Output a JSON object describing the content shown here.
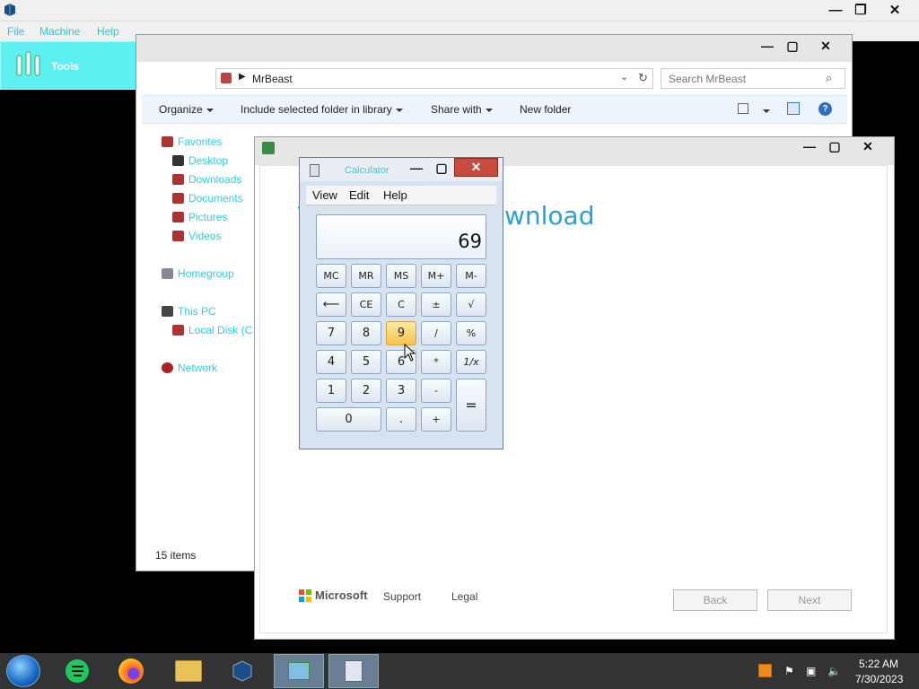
{
  "virtualbox": {
    "menu": [
      "File",
      "Machine",
      "Help"
    ],
    "tools_label": "Tools",
    "controls": [
      "—",
      "❐",
      "✕"
    ]
  },
  "explorer": {
    "address": "MrBeast",
    "search_placeholder": "Search MrBeast",
    "toolbar": {
      "organize": "Organize",
      "include": "Include selected folder in library",
      "share": "Share with",
      "new_folder": "New folder"
    },
    "nav": {
      "favorites": "Favorites",
      "desktop": "Desktop",
      "downloads": "Downloads",
      "documents": "Documents",
      "pictures": "Pictures",
      "videos": "Videos",
      "homegroup": "Homegroup",
      "this_pc": "This PC",
      "local_disk": "Local Disk (C:)",
      "network": "Network"
    },
    "status": "15 items"
  },
  "setup": {
    "heading_partial": "wnload",
    "brand": "Microsoft",
    "support": "Support",
    "legal": "Legal",
    "back": "Back",
    "next": "Next"
  },
  "calculator": {
    "title": "Calculator",
    "menu": {
      "view": "View",
      "edit": "Edit",
      "help": "Help"
    },
    "display": "69",
    "keys": {
      "mc": "MC",
      "mr": "MR",
      "ms": "MS",
      "mplus": "M+",
      "mminus": "M-",
      "back": "⟵",
      "ce": "CE",
      "c": "C",
      "pm": "±",
      "sqrt": "√",
      "k7": "7",
      "k8": "8",
      "k9": "9",
      "div": "/",
      "pct": "%",
      "k4": "4",
      "k5": "5",
      "k6": "6",
      "mul": "*",
      "inv": "1/x",
      "k1": "1",
      "k2": "2",
      "k3": "3",
      "sub": "-",
      "eq": "=",
      "k0": "0",
      "dot": ".",
      "add": "+"
    }
  },
  "taskbar": {
    "time": "5:22 AM",
    "date": "7/30/2023"
  },
  "colors": {
    "accent_cyan": "#2ad3e2",
    "setup_heading": "#2aa0d8",
    "calc_close": "#c94a3e",
    "key_hot": "#f6c54a"
  }
}
